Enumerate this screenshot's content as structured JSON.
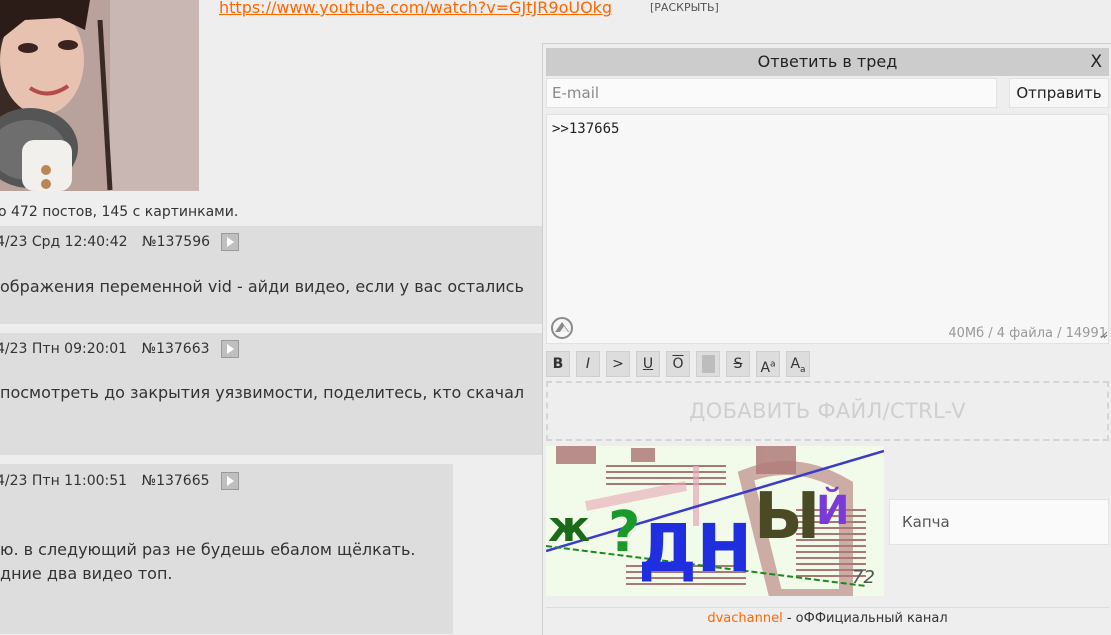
{
  "op": {
    "link": "https://www.youtube.com/watch?v=GJtJR9oUOkg",
    "expand": "[РАСКРЫТЬ]",
    "omitted": "о 472 постов, 145 с картинками."
  },
  "posts": [
    {
      "date": "4/23 Срд 12:40:42",
      "num": "№137596",
      "text": [
        "ображения переменной vid - айди видео, если у вас остались"
      ]
    },
    {
      "date": "4/23 Птн 09:20:01",
      "num": "№137663",
      "text": [
        "посмотреть до закрытия уязвимости, поделитесь, кто скачал"
      ]
    },
    {
      "date": "4/23 Птн 11:00:51",
      "num": "№137665",
      "text": [
        "ю. в следующий раз не будешь ебалом щёлкать.",
        "дние два видео топ."
      ]
    }
  ],
  "reply_form": {
    "title": "Ответить в тред",
    "close": "X",
    "email_placeholder": "E-mail",
    "send_label": "Отправить",
    "comment_value": ">>137665",
    "limits": "40Мб / 4 файла / 14991",
    "format_buttons": {
      "bold": "B",
      "italic": "I",
      "quote": ">",
      "underline": "U",
      "overline": "O",
      "strike": "S"
    },
    "dropzone": "ДОБАВИТЬ ФАЙЛ/CTRL-V",
    "captcha_placeholder": "Капча",
    "captcha_chars": [
      "ж",
      "?",
      "ДН",
      "Ы",
      "Й"
    ],
    "captcha_number": "72",
    "channel_link": "dvachannel",
    "channel_text": "- оФФициальный канал"
  },
  "colors": {
    "link": "#ff6600",
    "captcha_green": "#1a9a2a",
    "captcha_blue": "#1f2fe0",
    "captcha_olive": "#4a4a24",
    "captcha_purple": "#7a3ad8"
  },
  "icons": {
    "play": "play-icon",
    "sticker": "sticker-icon",
    "resize": "resize-grip-icon"
  }
}
